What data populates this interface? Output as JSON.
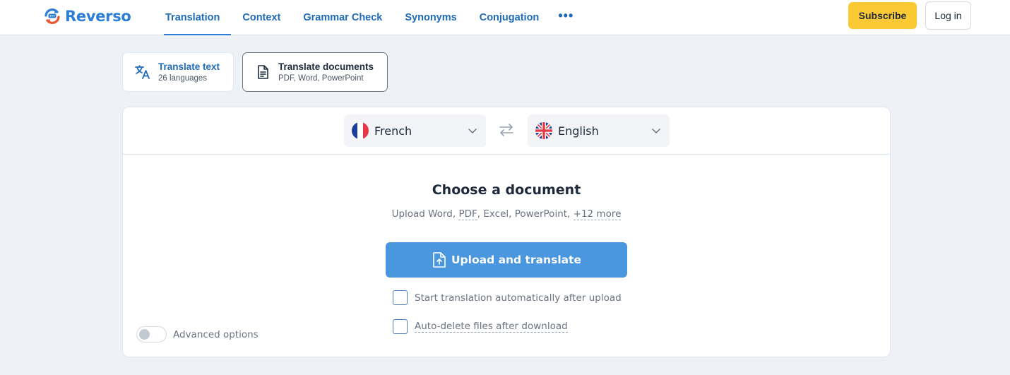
{
  "header": {
    "logo_text": "Reverso",
    "nav": [
      {
        "label": "Translation",
        "active": true
      },
      {
        "label": "Context"
      },
      {
        "label": "Grammar Check"
      },
      {
        "label": "Synonyms"
      },
      {
        "label": "Conjugation"
      },
      {
        "label": "•••"
      }
    ],
    "subscribe_label": "Subscribe",
    "login_label": "Log in"
  },
  "modes": {
    "text": {
      "title": "Translate text",
      "subtitle": "26 languages",
      "icon": "translate-icon"
    },
    "docs": {
      "title": "Translate documents",
      "subtitle": "PDF, Word, PowerPoint",
      "icon": "document-icon",
      "selected": true
    }
  },
  "languages": {
    "source": {
      "name": "French",
      "flag": "flag-fr-icon"
    },
    "target": {
      "name": "English",
      "flag": "flag-uk-icon"
    }
  },
  "document": {
    "title": "Choose a document",
    "sub_prefix": "Upload Word,",
    "sub_pdf": "PDF",
    "sub_middle": ", Excel, PowerPoint,",
    "sub_more": "+12 more",
    "upload_label": "Upload and translate",
    "option_auto_start": "Start translation automatically after upload",
    "option_auto_delete": "Auto-delete files after download",
    "advanced_label": "Advanced options"
  },
  "colors": {
    "brand_blue": "#2d7ed6",
    "nav_blue": "#1f6bb8",
    "upload_blue": "#4a97e0",
    "subscribe_yellow": "#fbc933",
    "page_bg": "#eef2f7"
  }
}
